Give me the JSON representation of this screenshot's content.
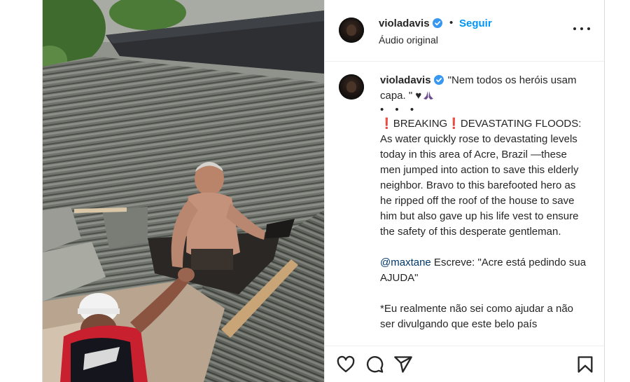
{
  "post": {
    "author": {
      "username": "violadavis",
      "verified": true,
      "avatar_icon": "avatar"
    },
    "header": {
      "separator": "•",
      "follow_label": "Seguir",
      "audio_label": "Áudio original",
      "more_icon": "more-options-icon"
    },
    "caption": {
      "username": "violadavis",
      "quote": "\"Nem todos os heróis usam capa. \"",
      "emoji_heart": "♥",
      "dots": "• • •",
      "breaking": "BREAKING",
      "headline": "DEVASTATING FLOODS:",
      "body": "As water quickly rose to devastating levels today in this area of Acre, Brazil —these men jumped into action to save this elderly neighbor. Bravo to this barefooted hero as he ripped off the roof of the house to save him but also gave up his life vest to ensure the safety of this desperate gentleman.",
      "mention": "@maxtane",
      "mention_text": " Escreve: \"Acre está pedindo sua AJUDA\"",
      "footnote": "*Eu realmente não sei como ajudar a não ser divulgando que este belo país"
    },
    "actions": {
      "like_icon": "heart-icon",
      "comment_icon": "comment-icon",
      "share_icon": "share-icon",
      "save_icon": "bookmark-icon"
    },
    "colors": {
      "link_blue": "#0095f6",
      "mention_blue": "#00376b",
      "text": "#262626",
      "verified_blue": "#3897f0",
      "alert_red": "#c62828"
    }
  }
}
